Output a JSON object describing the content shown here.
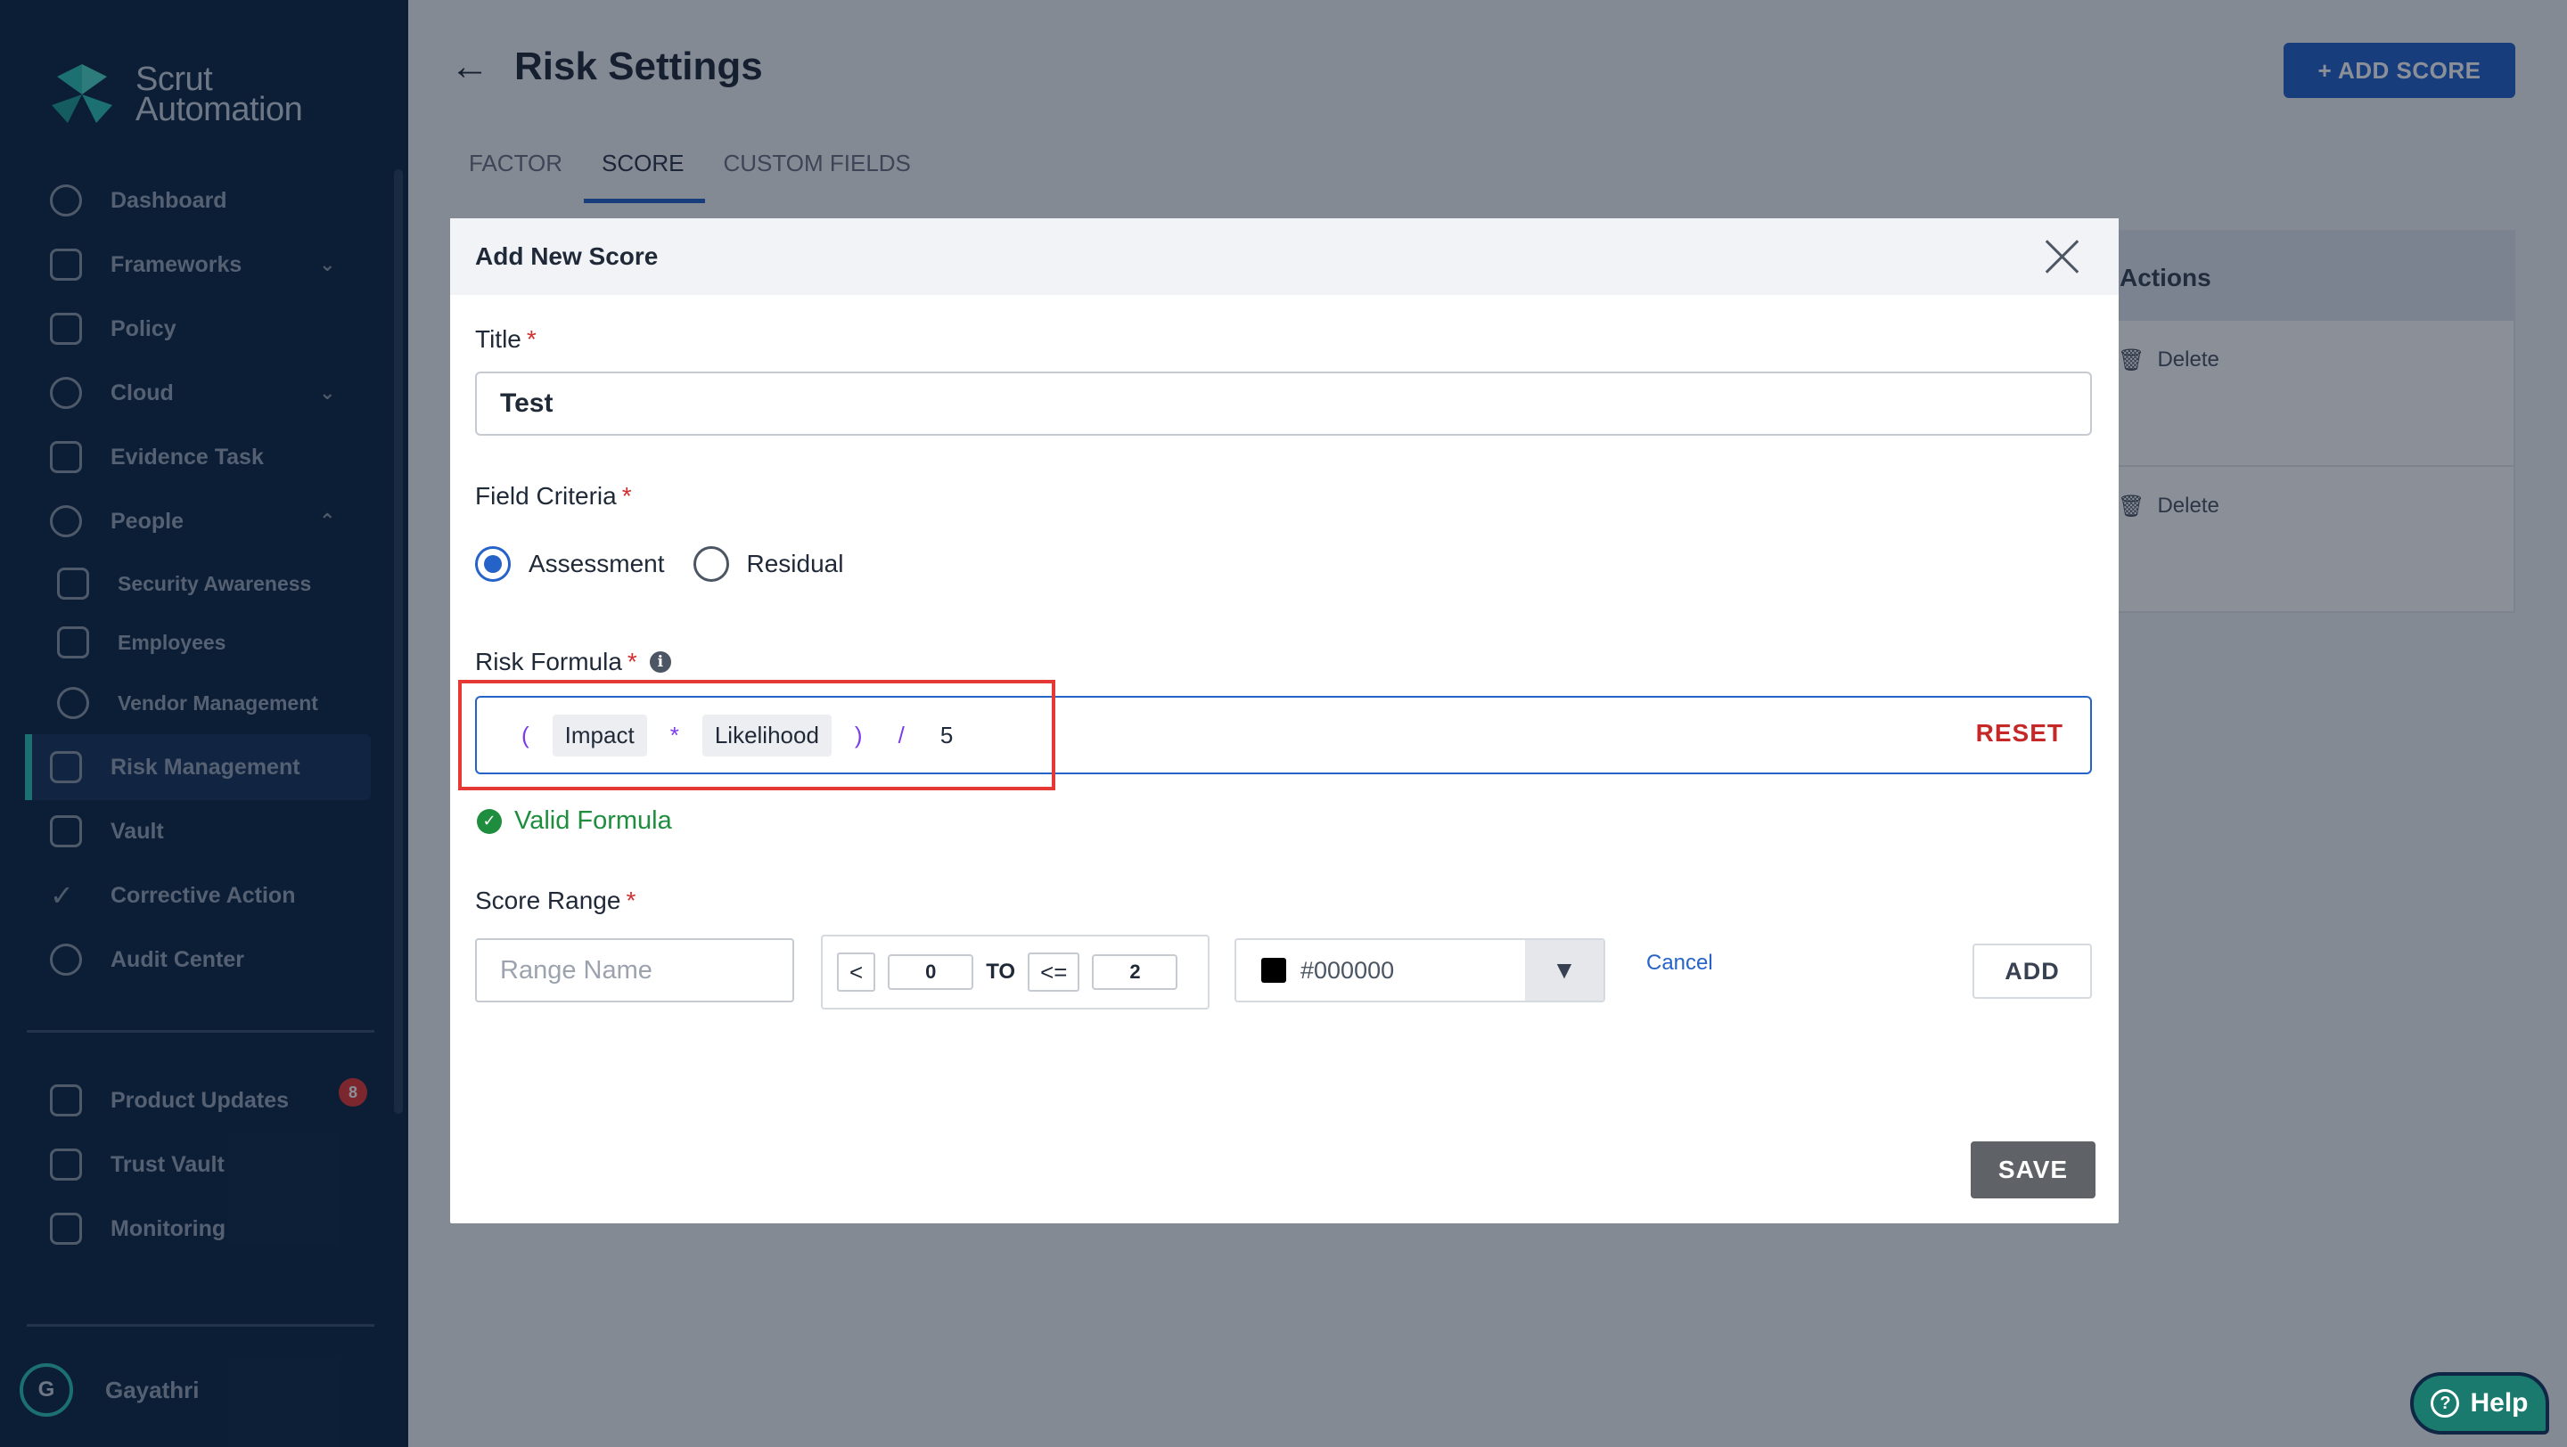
{
  "app": {
    "logo_text_line1": "Scrut",
    "logo_text_line2": "Automation"
  },
  "sidebar": {
    "items": [
      {
        "label": "Dashboard",
        "icon": "dashboard-icon"
      },
      {
        "label": "Frameworks",
        "icon": "frameworks-icon",
        "chevron": "down"
      },
      {
        "label": "Policy",
        "icon": "policy-icon"
      },
      {
        "label": "Cloud",
        "icon": "cloud-icon",
        "chevron": "down"
      },
      {
        "label": "Evidence Task",
        "icon": "evidence-icon"
      },
      {
        "label": "People",
        "icon": "people-icon",
        "chevron": "up"
      },
      {
        "label": "Security Awareness",
        "icon": "lock-icon"
      },
      {
        "label": "Employees",
        "icon": "employees-icon"
      },
      {
        "label": "Vendor Management",
        "icon": "globe-icon"
      },
      {
        "label": "Risk Management",
        "icon": "shield-icon",
        "active": true
      },
      {
        "label": "Vault",
        "icon": "vault-icon"
      },
      {
        "label": "Corrective Action",
        "icon": "check-icon"
      },
      {
        "label": "Audit Center",
        "icon": "audit-icon"
      }
    ],
    "bottom_items": [
      {
        "label": "Product Updates",
        "icon": "megaphone-icon",
        "badge": "8"
      },
      {
        "label": "Trust Vault",
        "icon": "flag-icon"
      },
      {
        "label": "Monitoring",
        "icon": "chart-icon"
      }
    ],
    "user": {
      "initial": "G",
      "name": "Gayathri"
    }
  },
  "page": {
    "title": "Risk Settings",
    "add_button": "+ ADD SCORE",
    "tabs": [
      {
        "label": "FACTOR"
      },
      {
        "label": "SCORE",
        "active": true
      },
      {
        "label": "CUSTOM FIELDS"
      }
    ],
    "table": {
      "actions_header": "Actions",
      "row_action": "Delete"
    }
  },
  "modal": {
    "title": "Add New Score",
    "title_label": "Title",
    "title_value": "Test",
    "criteria_label": "Field Criteria",
    "criteria_options": [
      {
        "label": "Assessment",
        "checked": true
      },
      {
        "label": "Residual",
        "checked": false
      }
    ],
    "formula_label": "Risk Formula",
    "formula_tokens": [
      "(",
      "Impact",
      "*",
      "Likelihood",
      ")",
      "/",
      "5"
    ],
    "reset_label": "RESET",
    "valid_text": "Valid Formula",
    "score_range_label": "Score Range",
    "range_name_placeholder": "Range Name",
    "range_lower_op": "<",
    "range_lower_value": "0",
    "range_to": "TO",
    "range_upper_op": "<=",
    "range_upper_value": "2",
    "color_value": "#000000",
    "cancel_label": "Cancel",
    "add_label": "ADD",
    "save_label": "SAVE"
  },
  "help": {
    "label": "Help"
  },
  "colors": {
    "sidebar_bg": "#0f2744",
    "primary": "#2563c9",
    "danger": "#c62828",
    "success": "#1e8e3e",
    "accent": "#2ec4b6"
  }
}
